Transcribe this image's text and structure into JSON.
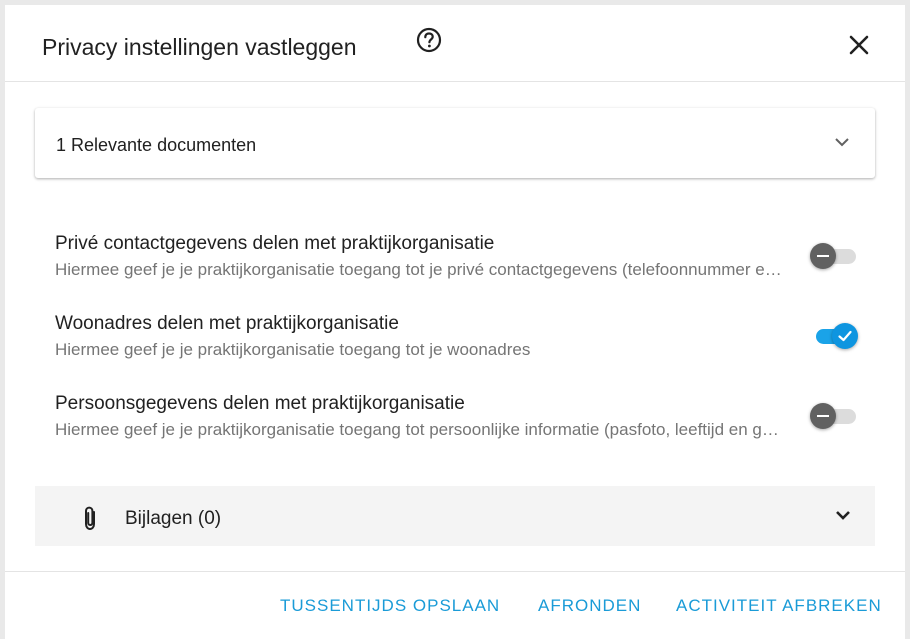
{
  "dialog": {
    "title": "Privacy instellingen vastleggen"
  },
  "documents": {
    "label": "1 Relevante documenten"
  },
  "settings": [
    {
      "title": "Privé contactgegevens delen met praktijkorganisatie",
      "description": "Hiermee geef je je praktijkorganisatie toegang tot je privé contactgegevens (telefoonnummer en e-mailadres)",
      "enabled": false
    },
    {
      "title": "Woonadres delen met praktijkorganisatie",
      "description": "Hiermee geef je je praktijkorganisatie toegang tot je woonadres",
      "enabled": true
    },
    {
      "title": "Persoonsgegevens delen met praktijkorganisatie",
      "description": "Hiermee geef je je praktijkorganisatie toegang tot persoonlijke informatie (pasfoto, leeftijd en geslacht)",
      "enabled": false
    }
  ],
  "attachments": {
    "label": "Bijlagen (0)"
  },
  "footer": {
    "save_label": "Tussentijds opslaan",
    "finish_label": "Afronden",
    "cancel_label": "Activiteit afbreken"
  },
  "colors": {
    "accent": "#1a9bd7",
    "toggle_on": "#0e95e0",
    "toggle_off_knob": "#616161"
  }
}
